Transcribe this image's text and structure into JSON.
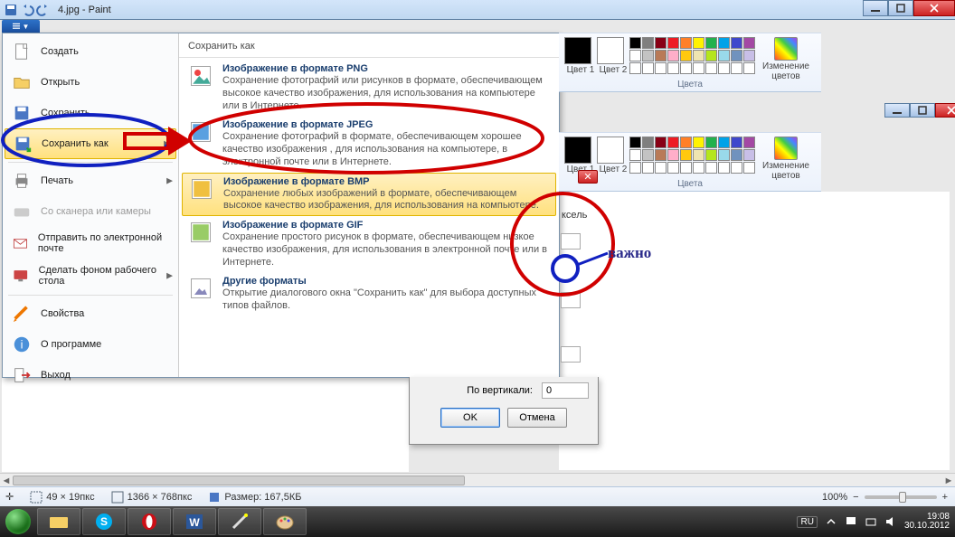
{
  "title": "4.jpg - Paint",
  "file_menu": {
    "items": [
      {
        "label": "Создать"
      },
      {
        "label": "Открыть"
      },
      {
        "label": "Сохранить"
      },
      {
        "label": "Сохранить как",
        "selected": true,
        "arrow": true
      },
      {
        "label": "Печать",
        "arrow": true
      },
      {
        "label": "Со сканера или камеры",
        "disabled": true
      },
      {
        "label": "Отправить по электронной почте"
      },
      {
        "label": "Сделать фоном рабочего стола",
        "arrow": true
      },
      {
        "label": "Свойства"
      },
      {
        "label": "О программе"
      },
      {
        "label": "Выход"
      }
    ]
  },
  "save_as": {
    "header": "Сохранить как",
    "formats": [
      {
        "title": "Изображение в формате PNG",
        "desc": "Сохранение фотографий или рисунков в формате, обеспечивающем высокое качество изображения, для использования на компьютере или в Интернете."
      },
      {
        "title": "Изображение в формате JPEG",
        "desc": "Сохранение фотографий в формате, обеспечивающем хорошее качество изображения , для использования на компьютере, в электронной почте или в Интернете."
      },
      {
        "title": "Изображение в формате BMP",
        "desc": "Сохранение любых изображений в формате, обеспечивающем высокое качество изображения, для использования на компьютере.",
        "selected": true
      },
      {
        "title": "Изображение в формате GIF",
        "desc": "Сохранение простого рисунок в формате, обеспечивающем низкое качество изображения, для использования в электронной почте или в Интернете."
      },
      {
        "title": "Другие форматы",
        "desc": "Открытие диалогового окна \"Сохранить как\" для выбора доступных типов файлов."
      }
    ]
  },
  "ribbon": {
    "color1_label": "Цвет\n1",
    "color2_label": "Цвет\n2",
    "edit_colors": "Изменение\nцветов",
    "section": "Цвета",
    "palette": [
      [
        "#000000",
        "#7f7f7f",
        "#880015",
        "#ed1c24",
        "#ff7f27",
        "#fff200",
        "#22b14c",
        "#00a2e8",
        "#3f48cc",
        "#a349a4"
      ],
      [
        "#ffffff",
        "#c3c3c3",
        "#b97a57",
        "#ffaec9",
        "#ffc90e",
        "#efe4b0",
        "#b5e61d",
        "#99d9ea",
        "#7092be",
        "#c8bfe7"
      ]
    ]
  },
  "note": "важно",
  "dialog": {
    "vert_label": "По вертикали:",
    "vert_value": "0",
    "ok": "OK",
    "cancel": "Отмена",
    "pixel_hint": "ксель"
  },
  "status": {
    "pos": "49 × 19пкс",
    "size": "1366 × 768пкс",
    "fsize": "Размер: 167,5КБ",
    "zoom": "100%"
  },
  "taskbar": {
    "lang": "RU",
    "time": "19:08",
    "date": "30.10.2012"
  }
}
